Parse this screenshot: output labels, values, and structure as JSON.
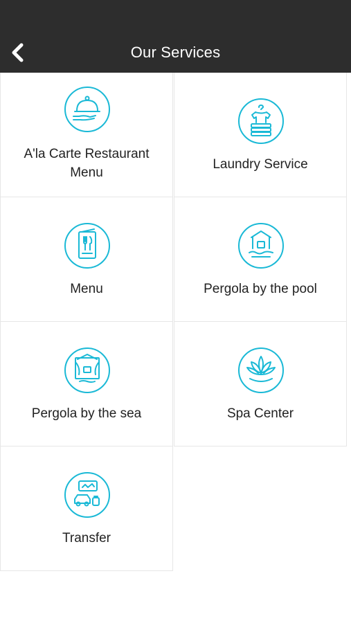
{
  "header": {
    "title": "Our Services",
    "back_icon": "chevron-left-icon"
  },
  "services": [
    {
      "label": "A'la Carte Restaurant Menu",
      "icon": "cloche-icon"
    },
    {
      "label": "Laundry Service",
      "icon": "laundry-icon"
    },
    {
      "label": "Menu",
      "icon": "menu-card-icon"
    },
    {
      "label": "Pergola by the pool",
      "icon": "pool-pergola-icon"
    },
    {
      "label": "Pergola by the sea",
      "icon": "sea-pergola-icon"
    },
    {
      "label": "Spa Center",
      "icon": "lotus-icon"
    },
    {
      "label": "Transfer",
      "icon": "car-icon"
    }
  ],
  "colors": {
    "accent": "#1ab9d6",
    "header_bg": "#2d2d2d"
  }
}
